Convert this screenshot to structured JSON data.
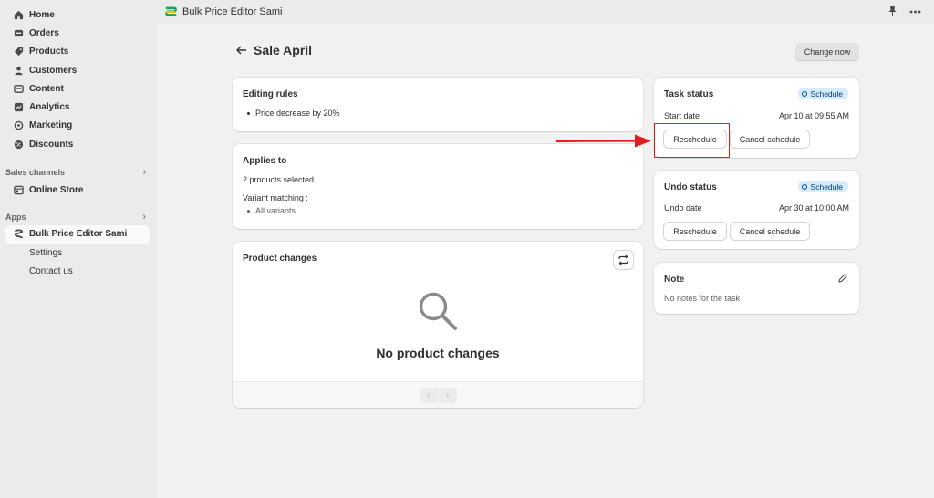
{
  "sidebar": {
    "items": [
      {
        "label": "Home",
        "icon": "home-icon"
      },
      {
        "label": "Orders",
        "icon": "orders-icon"
      },
      {
        "label": "Products",
        "icon": "tag-icon"
      },
      {
        "label": "Customers",
        "icon": "person-icon"
      },
      {
        "label": "Content",
        "icon": "content-icon"
      },
      {
        "label": "Analytics",
        "icon": "analytics-icon"
      },
      {
        "label": "Marketing",
        "icon": "marketing-icon"
      },
      {
        "label": "Discounts",
        "icon": "discount-icon"
      }
    ],
    "sales_channels_label": "Sales channels",
    "online_store": "Online Store",
    "apps_label": "Apps",
    "app_name": "Bulk Price Editor Sami",
    "settings": "Settings",
    "contact_us": "Contact us"
  },
  "topbar": {
    "app_name": "Bulk Price Editor Sami"
  },
  "page": {
    "title": "Sale April",
    "change_now": "Change now"
  },
  "editing_rules": {
    "title": "Editing rules",
    "rule": "Price decrease by 20%"
  },
  "applies_to": {
    "title": "Applies to",
    "selected": "2 products selected",
    "variant_label": "Variant matching :",
    "variant_value": "All variants"
  },
  "product_changes": {
    "title": "Product changes",
    "empty": "No product changes"
  },
  "task_status": {
    "title": "Task status",
    "badge": "Schedule",
    "date_label": "Start date",
    "date_value": "Apr 10 at 09:55 AM",
    "reschedule": "Reschedule",
    "cancel": "Cancel schedule"
  },
  "undo_status": {
    "title": "Undo status",
    "badge": "Schedule",
    "date_label": "Undo date",
    "date_value": "Apr 30 at 10:00 AM",
    "reschedule": "Reschedule",
    "cancel": "Cancel schedule"
  },
  "note": {
    "title": "Note",
    "empty": "No notes for the task"
  },
  "colors": {
    "badge_bg": "#d5ebff",
    "annotation_red": "#e02020"
  }
}
